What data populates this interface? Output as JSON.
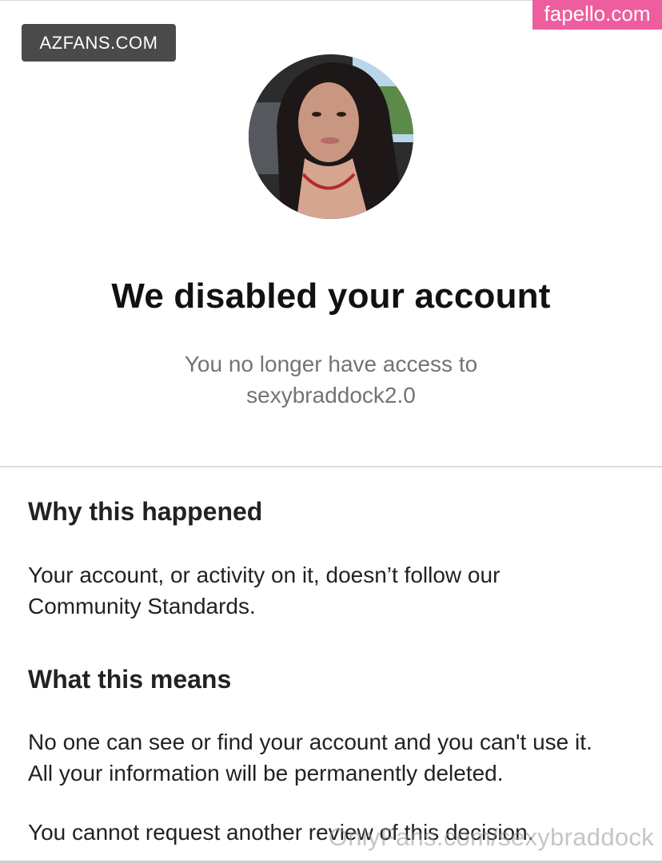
{
  "watermarks": {
    "top_left": "AZFANS.COM",
    "top_right": "fapello.com",
    "bottom": "OnlyFans.com/sexybraddock"
  },
  "header": {
    "title": "We disabled your account",
    "subtitle_line1": "You no longer have access to",
    "subtitle_line2": "sexybraddock2.0"
  },
  "sections": [
    {
      "heading": "Why this happened",
      "body": [
        "Your account, or activity on it, doesn’t follow our",
        "Community Standards."
      ]
    },
    {
      "heading": "What this means",
      "body": [
        "No one can see or find your account and you can't use it.",
        "All your information will be permanently deleted."
      ],
      "extra": "You cannot request another review of this decision."
    }
  ],
  "colors": {
    "azfans_badge": "#4a4a4a",
    "fapello_badge": "#ee5d9e",
    "subtitle_gray": "#737373"
  }
}
